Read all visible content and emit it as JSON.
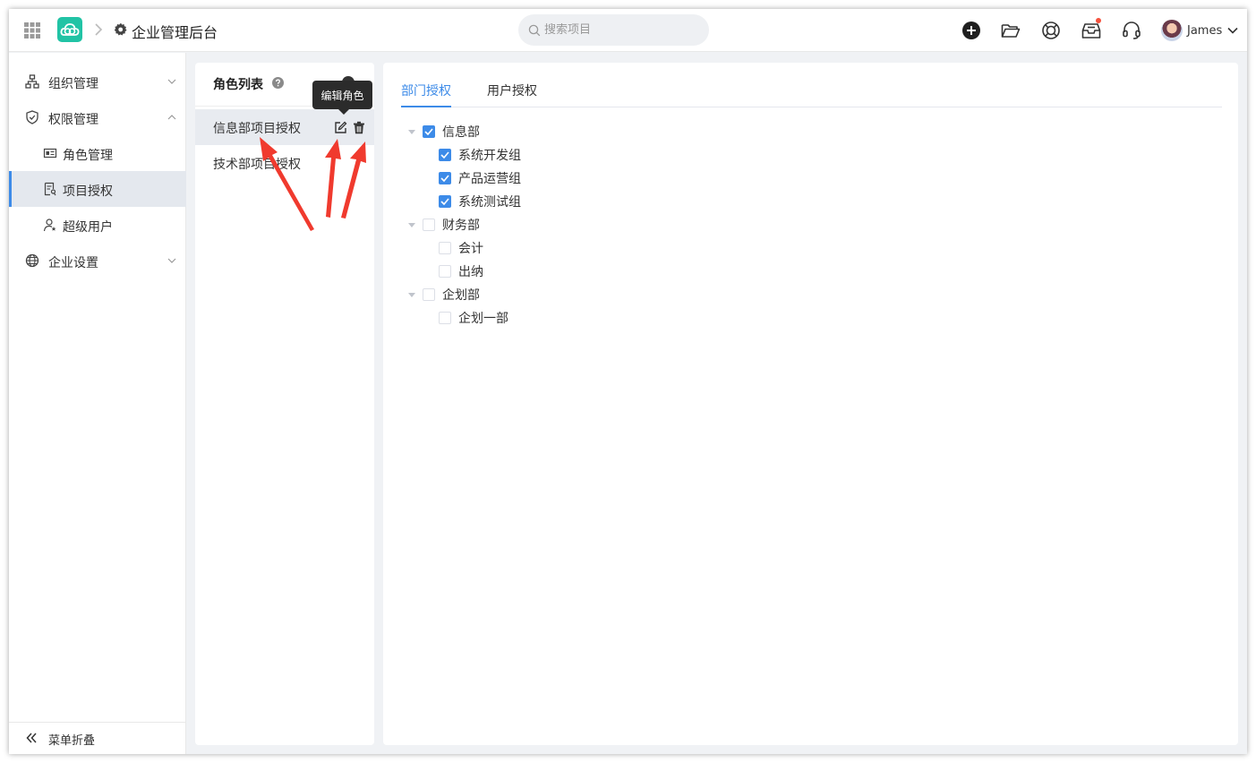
{
  "header": {
    "app_title": "企业管理后台",
    "search_placeholder": "搜索项目",
    "user_name": "James",
    "icons": [
      "grid-icon",
      "cloud-logo-icon",
      "gear-icon",
      "add-circle-icon",
      "folder-open-icon",
      "lifebuoy-icon",
      "inbox-icon",
      "headset-icon",
      "chevron-down-icon"
    ],
    "accent_color": "#21c3a5"
  },
  "sidebar": {
    "items": [
      {
        "label": "组织管理",
        "icon": "org-chart-icon"
      },
      {
        "label": "权限管理",
        "icon": "shield-icon"
      },
      {
        "label": "角色管理",
        "icon": "id-card-icon"
      },
      {
        "label": "项目授权",
        "icon": "document-key-icon"
      },
      {
        "label": "超级用户",
        "icon": "user-star-icon"
      },
      {
        "label": "企业设置",
        "icon": "globe-icon"
      }
    ],
    "collapse_label": "菜单折叠",
    "active_color": "#3d8be8"
  },
  "roles": {
    "title": "角色列表",
    "tooltip": "编辑角色",
    "items": [
      {
        "label": "信息部项目授权"
      },
      {
        "label": "技术部项目授权"
      }
    ]
  },
  "main": {
    "tabs": [
      {
        "label": "部门授权"
      },
      {
        "label": "用户授权"
      }
    ],
    "tree": [
      {
        "label": "信息部",
        "checked": true
      },
      {
        "label": "系统开发组",
        "checked": true
      },
      {
        "label": "产品运营组",
        "checked": true
      },
      {
        "label": "系统测试组",
        "checked": true
      },
      {
        "label": "财务部",
        "checked": false
      },
      {
        "label": "会计",
        "checked": false
      },
      {
        "label": "出纳",
        "checked": false
      },
      {
        "label": "企划部",
        "checked": false
      },
      {
        "label": "企划一部",
        "checked": false
      }
    ]
  }
}
